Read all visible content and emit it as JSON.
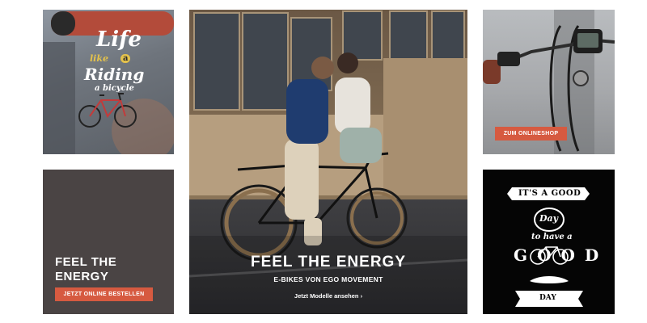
{
  "tiles": {
    "life": {
      "words": [
        "Life",
        "like",
        "a",
        "Riding",
        "a bicycle"
      ]
    },
    "energy": {
      "title": "FEEL THE ENERGY",
      "button": "JETZT ONLINE BESTELLEN"
    },
    "hero": {
      "title": "FEEL THE ENERGY",
      "subtitle": "E-BIKES VON EGO MOVEMENT",
      "link": "Jetzt Modelle ansehen ›"
    },
    "shop": {
      "button": "ZUM ONLINESHOP"
    },
    "good": {
      "words": [
        "IT'S A GOOD",
        "Day",
        "to have a",
        "GOOD",
        "DAY"
      ]
    }
  },
  "colors": {
    "accent": "#d65a40",
    "energy_bg": "#4a4444",
    "good_bg": "#050505"
  }
}
